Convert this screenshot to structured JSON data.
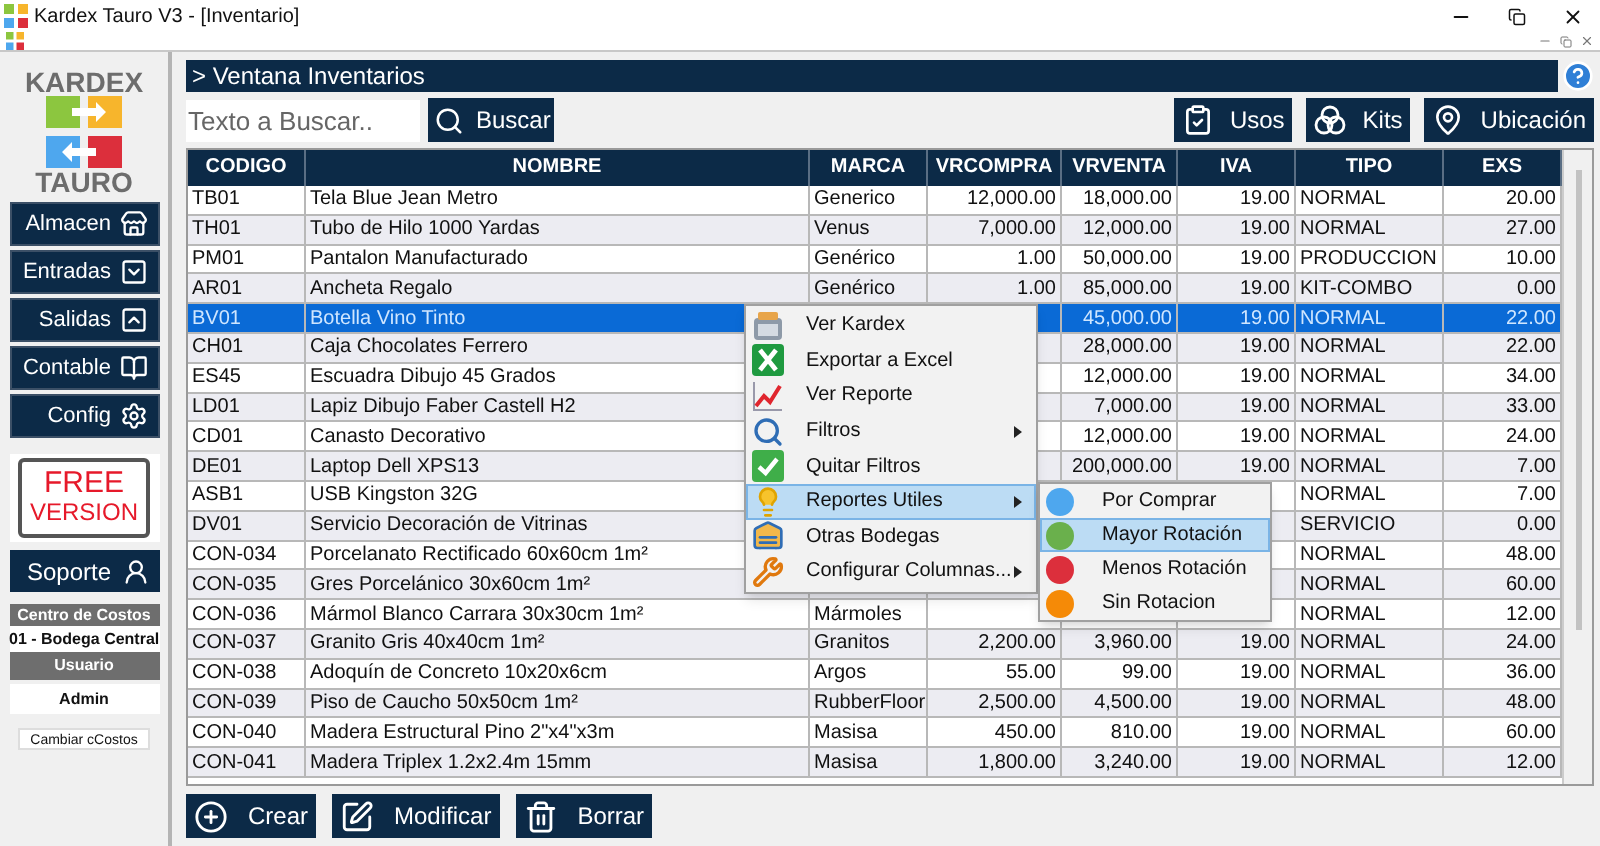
{
  "window": {
    "title": "Kardex Tauro V3 - [Inventario]"
  },
  "sidebar": {
    "logo_top": "KARDEX",
    "logo_bottom": "TAURO",
    "nav": [
      {
        "label": "Almacen",
        "kind": "store"
      },
      {
        "label": "Entradas",
        "kind": "in"
      },
      {
        "label": "Salidas",
        "kind": "out"
      },
      {
        "label": "Contable",
        "kind": "book"
      },
      {
        "label": "Config",
        "kind": "gear"
      }
    ],
    "badge": [
      "FREE",
      "VERSION"
    ],
    "support": "Soporte",
    "cost_center": {
      "label": "Centro de Costos",
      "value": "01 - Bodega Central"
    },
    "user": {
      "label": "Usuario",
      "value": "Admin"
    },
    "change_button": "Cambiar cCostos"
  },
  "header": {
    "title": "> Ventana Inventarios"
  },
  "search": {
    "placeholder": "Texto a Buscar..",
    "button": "Buscar"
  },
  "actions": [
    {
      "label": "Usos",
      "kind": "clipboard"
    },
    {
      "label": "Kits",
      "kind": "circles"
    },
    {
      "label": "Ubicación",
      "kind": "pin"
    }
  ],
  "table": {
    "columns": [
      "CODIGO",
      "NOMBRE",
      "MARCA",
      "VRCOMPRA",
      "VRVENTA",
      "IVA",
      "TIPO",
      "EXS"
    ],
    "rows": [
      {
        "selected": false,
        "cells": [
          "TB01",
          "Tela Blue Jean Metro",
          "Generico",
          "12,000.00",
          "18,000.00",
          "19.00",
          "NORMAL",
          "20.00"
        ]
      },
      {
        "selected": false,
        "cells": [
          "TH01",
          "Tubo de Hilo 1000 Yardas",
          "Venus",
          "7,000.00",
          "12,000.00",
          "19.00",
          "NORMAL",
          "27.00"
        ]
      },
      {
        "selected": false,
        "cells": [
          "PM01",
          "Pantalon Manufacturado",
          "Genérico",
          "1.00",
          "50,000.00",
          "19.00",
          "PRODUCCION",
          "10.00"
        ]
      },
      {
        "selected": false,
        "cells": [
          "AR01",
          "Ancheta Regalo",
          "Genérico",
          "1.00",
          "85,000.00",
          "19.00",
          "KIT-COMBO",
          "0.00"
        ]
      },
      {
        "selected": true,
        "cells": [
          "BV01",
          "Botella Vino Tinto",
          null,
          null,
          "45,000.00",
          "19.00",
          "NORMAL",
          "22.00"
        ]
      },
      {
        "selected": false,
        "cells": [
          "CH01",
          "Caja Chocolates Ferrero",
          null,
          null,
          "28,000.00",
          "19.00",
          "NORMAL",
          "22.00"
        ]
      },
      {
        "selected": false,
        "cells": [
          "ES45",
          "Escuadra Dibujo 45 Grados",
          null,
          null,
          "12,000.00",
          "19.00",
          "NORMAL",
          "34.00"
        ]
      },
      {
        "selected": false,
        "cells": [
          "LD01",
          "Lapiz Dibujo Faber Castell H2",
          null,
          null,
          "7,000.00",
          "19.00",
          "NORMAL",
          "33.00"
        ]
      },
      {
        "selected": false,
        "cells": [
          "CD01",
          "Canasto Decorativo",
          null,
          null,
          "12,000.00",
          "19.00",
          "NORMAL",
          "24.00"
        ]
      },
      {
        "selected": false,
        "cells": [
          "DE01",
          "Laptop Dell XPS13",
          null,
          null,
          "200,000.00",
          "19.00",
          "NORMAL",
          "7.00"
        ]
      },
      {
        "selected": false,
        "cells": [
          "ASB1",
          "USB Kingston 32G",
          null,
          null,
          null,
          null,
          "NORMAL",
          "7.00"
        ]
      },
      {
        "selected": false,
        "cells": [
          "DV01",
          "Servicio Decoración de Vitrinas",
          null,
          null,
          null,
          null,
          "SERVICIO",
          "0.00"
        ]
      },
      {
        "selected": false,
        "cells": [
          "CON-034",
          "Porcelanato Rectificado 60x60cm 1m²",
          null,
          null,
          null,
          null,
          "NORMAL",
          "48.00"
        ]
      },
      {
        "selected": false,
        "cells": [
          "CON-035",
          "Gres Porcelánico 30x60cm 1m²",
          null,
          null,
          null,
          null,
          "NORMAL",
          "60.00"
        ]
      },
      {
        "selected": false,
        "cells": [
          "CON-036",
          "Mármol Blanco Carrara 30x30cm 1m²",
          "Mármoles",
          null,
          null,
          null,
          "NORMAL",
          "12.00"
        ]
      },
      {
        "selected": false,
        "cells": [
          "CON-037",
          "Granito Gris 40x40cm 1m²",
          "Granitos",
          "2,200.00",
          "3,960.00",
          "19.00",
          "NORMAL",
          "24.00"
        ]
      },
      {
        "selected": false,
        "cells": [
          "CON-038",
          "Adoquín de Concreto 10x20x6cm",
          "Argos",
          "55.00",
          "99.00",
          "19.00",
          "NORMAL",
          "36.00"
        ]
      },
      {
        "selected": false,
        "cells": [
          "CON-039",
          "Piso de Caucho 50x50cm 1m²",
          "RubberFloor",
          "2,500.00",
          "4,500.00",
          "19.00",
          "NORMAL",
          "48.00"
        ]
      },
      {
        "selected": false,
        "cells": [
          "CON-040",
          "Madera Estructural Pino 2\"x4\"x3m",
          "Masisa",
          "450.00",
          "810.00",
          "19.00",
          "NORMAL",
          "60.00"
        ]
      },
      {
        "selected": false,
        "cells": [
          "CON-041",
          "Madera Triplex 1.2x2.4m 15mm",
          "Masisa",
          "1,800.00",
          "3,240.00",
          "19.00",
          "NORMAL",
          "12.00"
        ]
      }
    ]
  },
  "context_menu": [
    {
      "label": "Ver Kardex",
      "kind": "kardex",
      "has_submenu": false,
      "selected": false
    },
    {
      "label": "Exportar a Excel",
      "kind": "excel",
      "has_submenu": false,
      "selected": false
    },
    {
      "label": "Ver Reporte",
      "kind": "chart",
      "has_submenu": false,
      "selected": false
    },
    {
      "label": "Filtros",
      "kind": "search",
      "has_submenu": true,
      "selected": false
    },
    {
      "label": "Quitar Filtros",
      "kind": "check",
      "has_submenu": false,
      "selected": false
    },
    {
      "label": "Reportes Utiles",
      "kind": "bulb",
      "has_submenu": true,
      "selected": true
    },
    {
      "label": "Otras Bodegas",
      "kind": "warehouse",
      "has_submenu": false,
      "selected": false
    },
    {
      "label": "Configurar Columnas...",
      "kind": "tools",
      "has_submenu": true,
      "selected": false
    }
  ],
  "submenu": [
    {
      "label": "Por Comprar",
      "color": "#4ea7ee",
      "selected": false
    },
    {
      "label": "Mayor Rotación",
      "color": "#6ab04c",
      "selected": true
    },
    {
      "label": "Menos Rotación",
      "color": "#dc2f3c",
      "selected": false
    },
    {
      "label": "Sin Rotacion",
      "color": "#f58a07",
      "selected": false
    }
  ],
  "bottom_buttons": [
    {
      "label": "Crear",
      "kind": "plus"
    },
    {
      "label": "Modificar",
      "kind": "edit"
    },
    {
      "label": "Borrar",
      "kind": "trash"
    }
  ]
}
